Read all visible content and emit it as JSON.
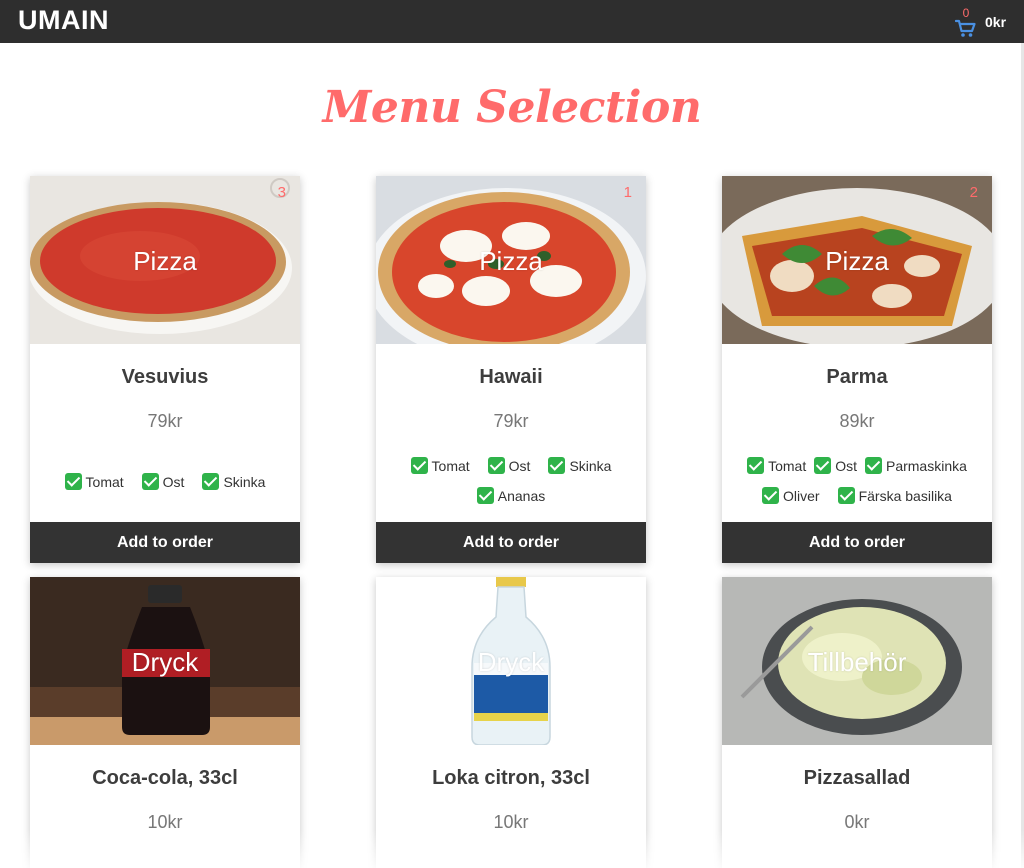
{
  "header": {
    "brand": "UMAIN",
    "cart_count": "0",
    "cart_total": "0kr"
  },
  "title": "Menu Selection",
  "menu": [
    {
      "category": "Pizza",
      "name": "Vesuvius",
      "price": "79kr",
      "badge": "3",
      "ingredients": [
        "Tomat",
        "Ost",
        "Skinka"
      ],
      "button": "Add to order"
    },
    {
      "category": "Pizza",
      "name": "Hawaii",
      "price": "79kr",
      "badge": "1",
      "ingredients": [
        "Tomat",
        "Ost",
        "Skinka",
        "Ananas"
      ],
      "button": "Add to order"
    },
    {
      "category": "Pizza",
      "name": "Parma",
      "price": "89kr",
      "badge": "2",
      "ingredients": [
        "Tomat",
        "Ost",
        "Parmaskinka",
        "Oliver",
        "Färska basilika"
      ],
      "button": "Add to order"
    },
    {
      "category": "Dryck",
      "name": "Coca-cola, 33cl",
      "price": "10kr"
    },
    {
      "category": "Dryck",
      "name": "Loka citron, 33cl",
      "price": "10kr"
    },
    {
      "category": "Tillbehör",
      "name": "Pizzasallad",
      "price": "0kr"
    }
  ],
  "icons": {
    "cart": "shopping-cart-icon",
    "ingredient_check": "check-box-icon"
  },
  "colors": {
    "accent": "#ff6b6b",
    "header_bg": "#2e2e2e",
    "button_bg": "#333333",
    "check": "#2fb34a",
    "cart_icon": "#4a90e2"
  }
}
